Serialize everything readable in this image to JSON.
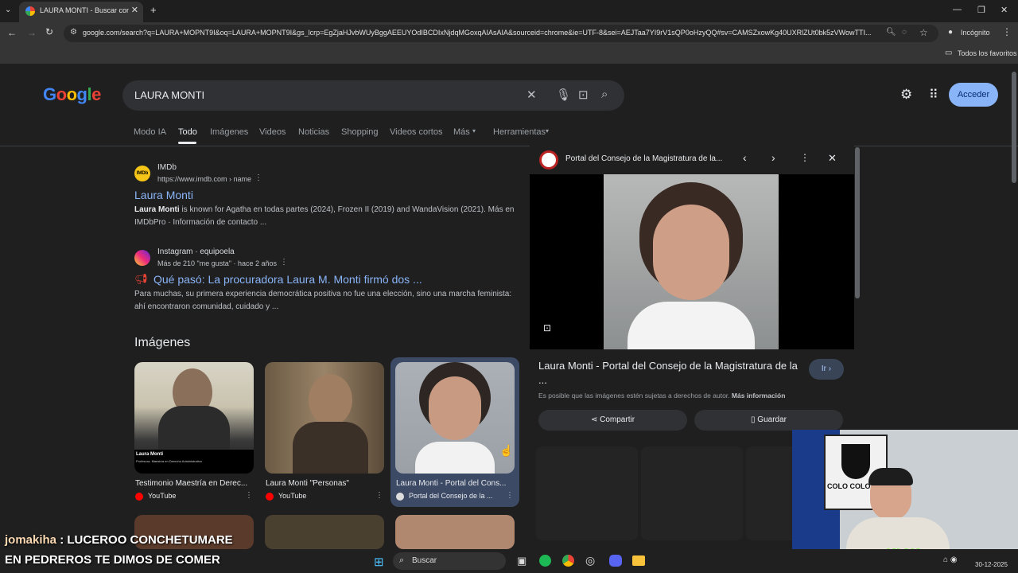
{
  "browser": {
    "tab_title": "LAURA MONTI - Buscar con Go...",
    "url": "google.com/search?q=LAURA+MOPNT9I&oq=LAURA+MOPNT9I&gs_lcrp=EgZjaHJvbWUyBggAEEUYOdIBCDIxNjdqMGoxqAIAsAIA&sourceid=chrome&ie=UTF-8&sei=AEJTaa7YI9rV1sQP0oHzyQQ#sv=CAMSZxowKg40UXRlZUt0bk5zVWowTTI...",
    "incognito_label": "Incógnito",
    "bookmarks_label": "Todos los favoritos"
  },
  "search": {
    "query": "LAURA MONTI",
    "signin_label": "Acceder"
  },
  "nav": {
    "items": [
      "Modo IA",
      "Todo",
      "Imágenes",
      "Videos",
      "Noticias",
      "Shopping",
      "Videos cortos",
      "Más",
      "Herramientas"
    ]
  },
  "results": [
    {
      "source": "IMDb",
      "url": "https://www.imdb.com › name",
      "title": "Laura Monti",
      "snippet_bold": "Laura Monti",
      "snippet": " is known for Agatha en todas partes (2024), Frozen II (2019) and WandaVision (2021). Más en IMDbPro · Información de contacto ..."
    },
    {
      "source": "Instagram · equipoela",
      "url": "Más de 210 \"me gusta\" · hace 2 años",
      "title": "Qué pasó: La procuradora Laura M. Monti firmó dos ...",
      "snippet": "Para muchas, su primera experiencia democrática positiva no fue una elección, sino una marcha feminista: ahí encontraron comunidad, cuidado y ..."
    }
  ],
  "images": {
    "heading": "Imágenes",
    "items": [
      {
        "caption": "Testimonio Maestría en Derec...",
        "source": "YouTube",
        "overlay_name": "Laura Monti",
        "overlay_sub": "Profesora. Maestría en Derecho Administrativo"
      },
      {
        "caption": "Laura Monti \"Personas\"",
        "source": "YouTube"
      },
      {
        "caption": "Laura Monti - Portal del Cons...",
        "source": "Portal del Consejo de la ..."
      }
    ]
  },
  "panel": {
    "header": "Portal del Consejo de la Magistratura de la...",
    "title": "Laura Monti - Portal del Consejo de la Magistratura de la ...",
    "go_label": "Ir",
    "copyright": "Es posible que las imágenes estén sujetas a derechos de autor.",
    "more_info": "Más información",
    "share_label": "Compartir",
    "save_label": "Guardar"
  },
  "overlay": {
    "chat_user": "jomakiha",
    "chat_line1": " : LUCEROO CONCHETUMARE",
    "chat_line2": "EN PEDREROS TE DIMOS DE COMER",
    "webcam_banner": "COLO COLO",
    "kick_label": "KICK",
    "taskbar_search": "Buscar",
    "date": "30-12-2025"
  }
}
